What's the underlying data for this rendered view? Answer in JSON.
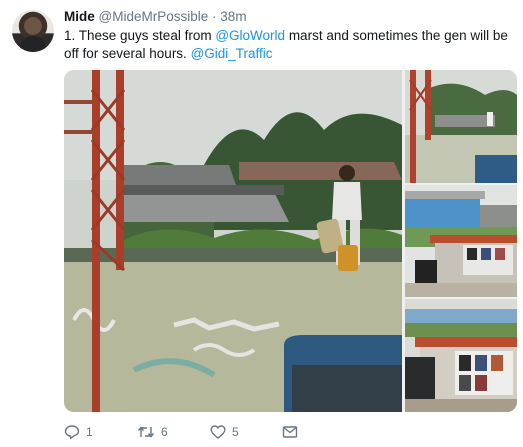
{
  "tweet": {
    "name": "Mide",
    "handle": "@MideMrPossible",
    "separator": "·",
    "time": "38m",
    "text_start": "1. These guys steal from ",
    "mention1": "@GloWorld",
    "text_mid": " marst and sometimes the gen will be off for several hours. ",
    "mention2": "@Gidi_Traffic"
  },
  "actions": {
    "reply_count": "1",
    "retweet_count": "6",
    "like_count": "5"
  },
  "icons": {
    "reply": "reply-icon",
    "retweet": "retweet-icon",
    "like": "heart-icon",
    "dm": "envelope-icon"
  },
  "colors": {
    "text": "#14171a",
    "muted": "#657786",
    "link": "#1b95e0"
  }
}
